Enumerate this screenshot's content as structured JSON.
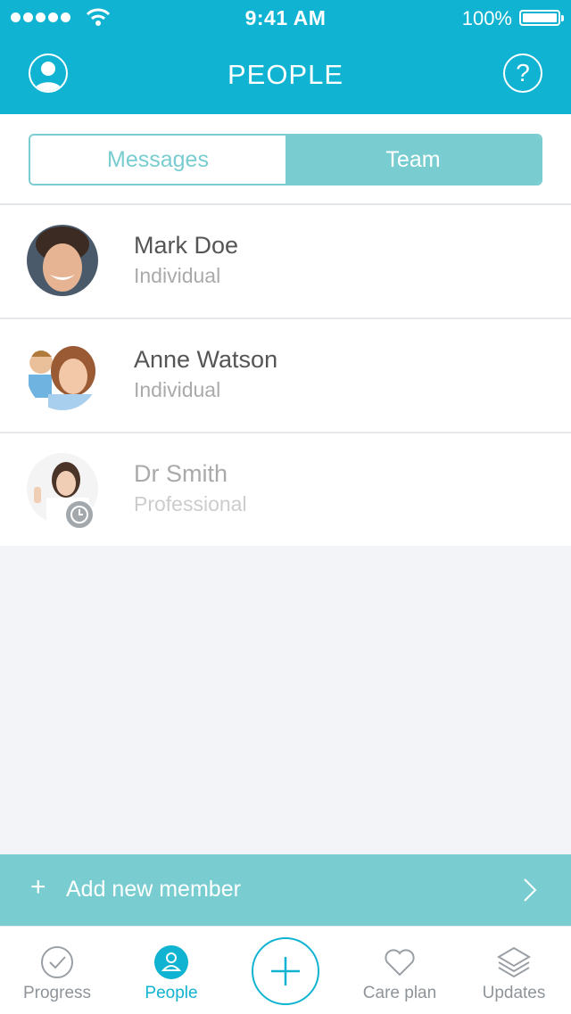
{
  "status_bar": {
    "time": "9:41 AM",
    "battery": "100%"
  },
  "header": {
    "title": "PEOPLE",
    "help_label": "?"
  },
  "segments": {
    "left": "Messages",
    "right": "Team",
    "selected": "Team"
  },
  "members": [
    {
      "name": "Mark Doe",
      "role": "Individual",
      "pending": false
    },
    {
      "name": "Anne Watson",
      "role": "Individual",
      "pending": false
    },
    {
      "name": "Dr Smith",
      "role": "Professional",
      "pending": true
    }
  ],
  "add_member": {
    "plus": "+",
    "label": "Add new member"
  },
  "tabs": [
    {
      "label": "Progress",
      "icon": "check-circle-icon"
    },
    {
      "label": "People",
      "icon": "person-icon"
    },
    {
      "label": "",
      "icon": "plus-icon"
    },
    {
      "label": "Care plan",
      "icon": "heart-icon"
    },
    {
      "label": "Updates",
      "icon": "layers-icon"
    }
  ],
  "colors": {
    "primary": "#10b3d1",
    "accent": "#79cdd0",
    "background": "#f2f4f7"
  }
}
